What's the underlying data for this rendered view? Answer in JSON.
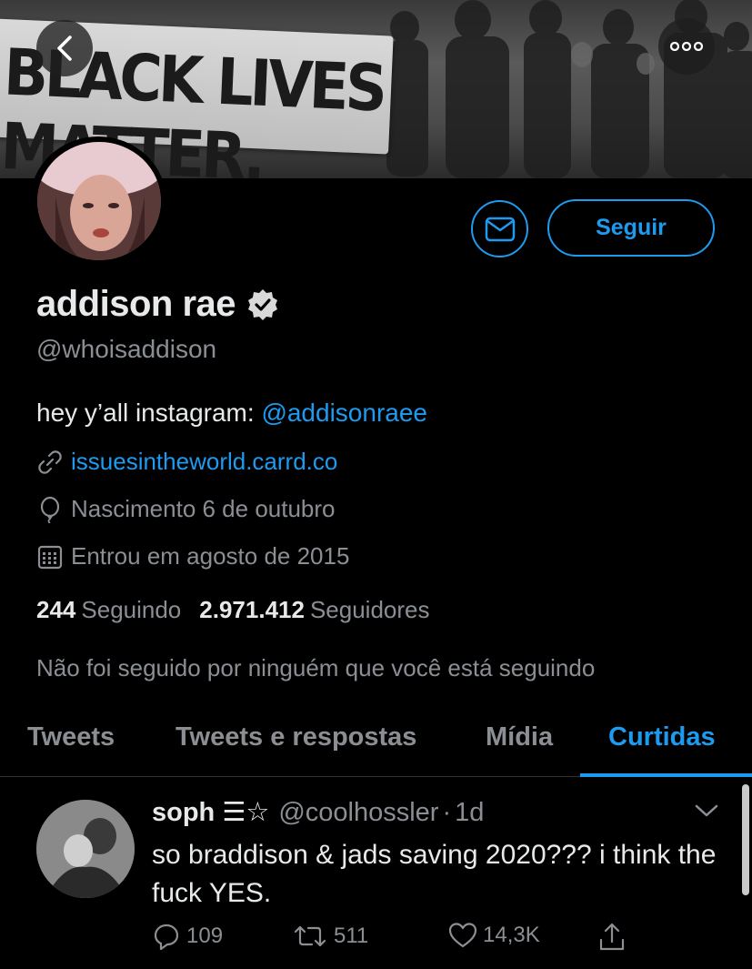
{
  "banner": {
    "sign_text": "BLACK LIVES MATTER."
  },
  "header": {
    "back_icon": "chevron-left-icon",
    "more_icon": "more-dots-icon"
  },
  "profile": {
    "display_name": "addison rae",
    "verified_icon": "verified-badge-icon",
    "handle": "@whoisaddison",
    "bio_text": "hey y’all instagram: ",
    "bio_link": "@addisonraee",
    "website": "issuesintheworld.carrd.co",
    "birth": "Nascimento 6 de outubro",
    "joined": "Entrou em agosto de 2015",
    "following_count": "244",
    "following_label": "Seguindo",
    "followers_count": "2.971.412",
    "followers_label": "Seguidores",
    "followed_by": "Não foi seguido por ninguém que você está seguindo"
  },
  "actions": {
    "message_icon": "mail-icon",
    "follow_label": "Seguir"
  },
  "tabs": [
    {
      "label": "Tweets",
      "active": false
    },
    {
      "label": "Tweets e respostas",
      "active": false
    },
    {
      "label": "Mídia",
      "active": false
    },
    {
      "label": "Curtidas",
      "active": true
    }
  ],
  "tweet": {
    "author": "soph",
    "author_suffix": "☰☆",
    "handle": "@coolhossler",
    "separator": "·",
    "time": "1d",
    "text": "so braddison & jads saving 2020??? i think the fuck YES.",
    "replies": "109",
    "retweets": "511",
    "likes": "14,3K"
  },
  "colors": {
    "accent": "#1d9bf0",
    "background": "#000000",
    "secondary_text": "#8b8f94"
  }
}
